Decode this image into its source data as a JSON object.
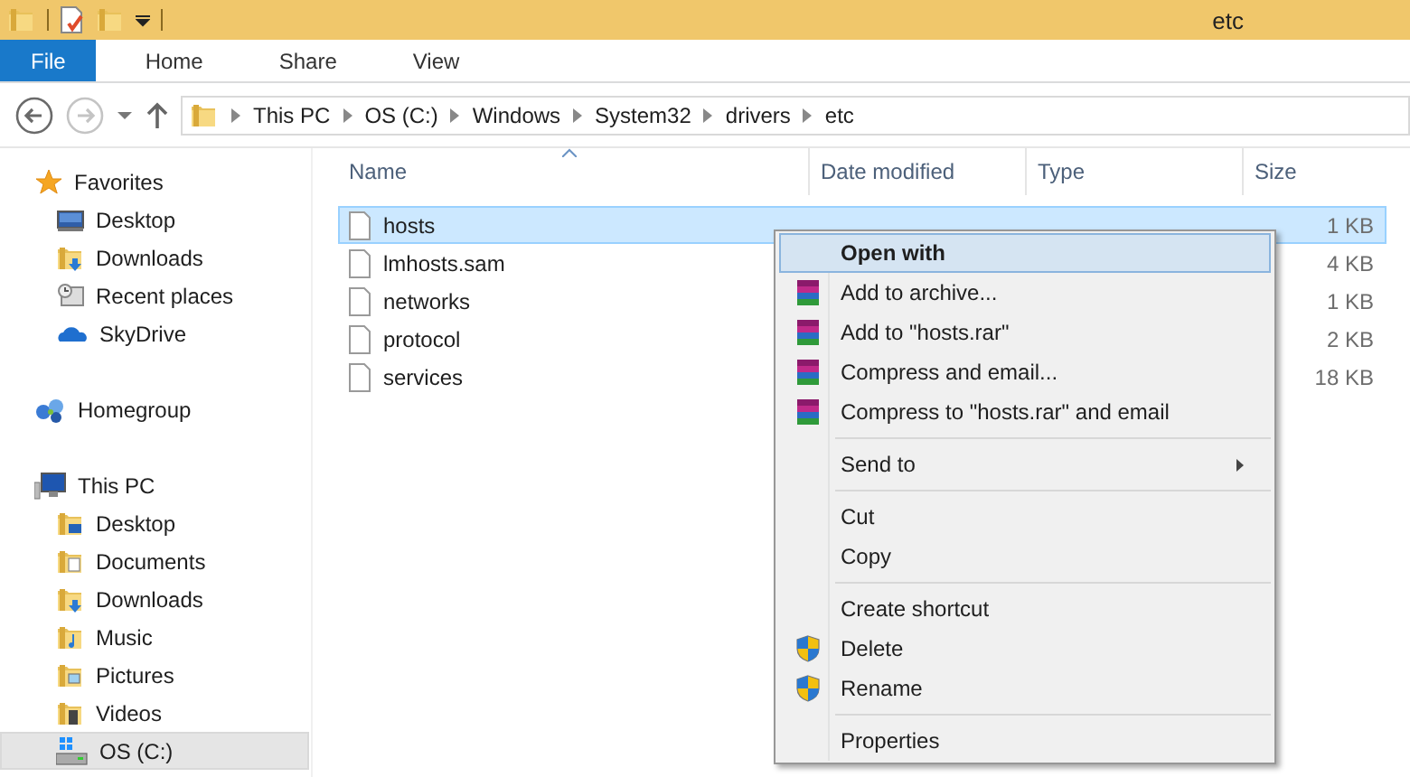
{
  "window": {
    "title": "etc"
  },
  "ribbon_tabs": [
    {
      "label": "File",
      "kind": "file",
      "selected": false
    },
    {
      "label": "Home",
      "kind": "tab",
      "selected": false
    },
    {
      "label": "Share",
      "kind": "tab",
      "selected": false
    },
    {
      "label": "View",
      "kind": "tab",
      "selected": false
    }
  ],
  "nav": [
    {
      "kind": "back",
      "disabled": false
    },
    {
      "kind": "forward",
      "disabled": true
    }
  ],
  "breadcrumbs": [
    "This PC",
    "OS (C:)",
    "Windows",
    "System32",
    "drivers",
    "etc"
  ],
  "sidebar": [
    {
      "label": "Favorites",
      "kind": "star",
      "selected": false,
      "children": [
        {
          "label": "Desktop",
          "kind": "monitor",
          "selected": false
        },
        {
          "label": "Downloads",
          "kind": "downloads",
          "selected": false
        },
        {
          "label": "Recent places",
          "kind": "recent",
          "selected": false
        },
        {
          "label": "SkyDrive",
          "kind": "cloud",
          "selected": false
        }
      ]
    },
    {
      "label": "Homegroup",
      "kind": "homegroup",
      "selected": false
    },
    {
      "label": "This PC",
      "kind": "pc",
      "selected": false,
      "children": [
        {
          "label": "Desktop",
          "kind": "desktopfolder",
          "selected": false
        },
        {
          "label": "Documents",
          "kind": "documents",
          "selected": false
        },
        {
          "label": "Downloads",
          "kind": "downloads",
          "selected": false
        },
        {
          "label": "Music",
          "kind": "music",
          "selected": false
        },
        {
          "label": "Pictures",
          "kind": "pictures",
          "selected": false
        },
        {
          "label": "Videos",
          "kind": "videos",
          "selected": false
        },
        {
          "label": "OS (C:)",
          "kind": "drive",
          "selected": true
        }
      ]
    }
  ],
  "columns": [
    "Name",
    "Date modified",
    "Type",
    "Size"
  ],
  "files": [
    {
      "name": "hosts",
      "size": "1 KB",
      "selected": true
    },
    {
      "name": "lmhosts.sam",
      "size": "4 KB",
      "selected": false
    },
    {
      "name": "networks",
      "size": "1 KB",
      "selected": false
    },
    {
      "name": "protocol",
      "size": "2 KB",
      "selected": false
    },
    {
      "name": "services",
      "size": "18 KB",
      "selected": false
    }
  ],
  "context_menu": [
    {
      "kind": "plain",
      "label": "Open with",
      "default": true,
      "selected": true,
      "submenu": false
    },
    {
      "kind": "archive",
      "label": "Add to archive...",
      "default": false,
      "selected": false,
      "submenu": false
    },
    {
      "kind": "archive",
      "label": "Add to \"hosts.rar\"",
      "default": false,
      "selected": false,
      "submenu": false
    },
    {
      "kind": "archive",
      "label": "Compress and email...",
      "default": false,
      "selected": false,
      "submenu": false
    },
    {
      "kind": "archive",
      "label": "Compress to \"hosts.rar\" and email",
      "default": false,
      "selected": false,
      "submenu": false
    },
    {
      "kind": "separator"
    },
    {
      "kind": "plain",
      "label": "Send to",
      "default": false,
      "selected": false,
      "submenu": true
    },
    {
      "kind": "separator"
    },
    {
      "kind": "plain",
      "label": "Cut",
      "default": false,
      "selected": false,
      "submenu": false
    },
    {
      "kind": "plain",
      "label": "Copy",
      "default": false,
      "selected": false,
      "submenu": false
    },
    {
      "kind": "separator"
    },
    {
      "kind": "plain",
      "label": "Create shortcut",
      "default": false,
      "selected": false,
      "submenu": false
    },
    {
      "kind": "shield",
      "label": "Delete",
      "default": false,
      "selected": false,
      "submenu": false
    },
    {
      "kind": "shield",
      "label": "Rename",
      "default": false,
      "selected": false,
      "submenu": false
    },
    {
      "kind": "separator"
    },
    {
      "kind": "plain",
      "label": "Properties",
      "default": false,
      "selected": false,
      "submenu": false
    }
  ]
}
